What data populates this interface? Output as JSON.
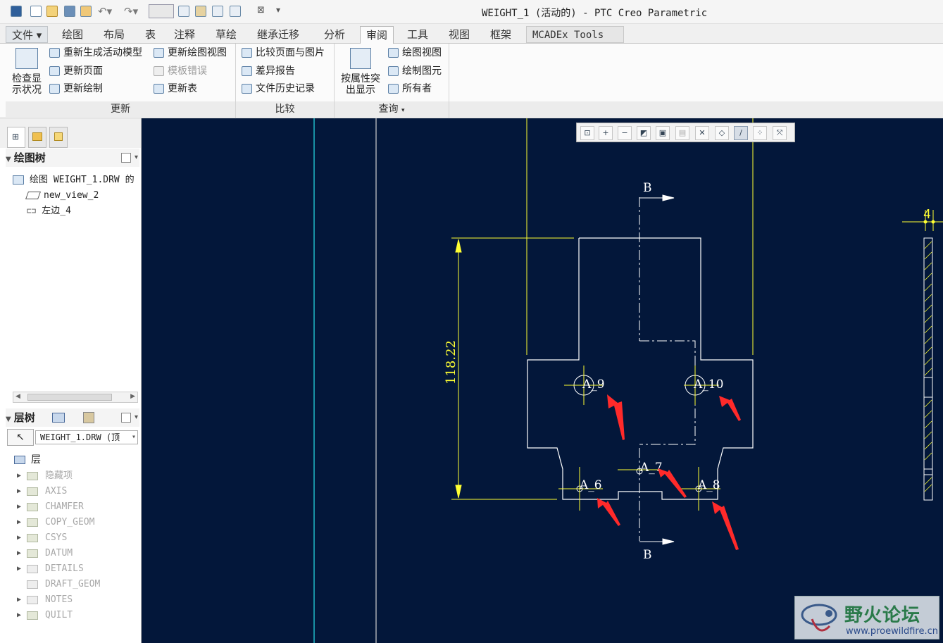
{
  "window": {
    "title": "WEIGHT_1 (活动的) - PTC Creo Parametric"
  },
  "tabs": [
    {
      "label": "文件"
    },
    {
      "label": "绘图"
    },
    {
      "label": "布局"
    },
    {
      "label": "表"
    },
    {
      "label": "注释"
    },
    {
      "label": "草绘"
    },
    {
      "label": "继承迁移"
    },
    {
      "label": "分析"
    },
    {
      "label": "审阅"
    },
    {
      "label": "工具"
    },
    {
      "label": "视图"
    },
    {
      "label": "框架"
    },
    {
      "label": "MCADEx Tools"
    }
  ],
  "ribbon": {
    "update": {
      "big_button": "检查显示状况",
      "big_button_line1": "检查显",
      "big_button_line2": "示状况",
      "items": [
        "重新生成活动模型",
        "更新页面",
        "更新绘制",
        "更新绘图视图",
        "模板错误",
        "更新表"
      ],
      "label": "更新"
    },
    "compare": {
      "items": [
        "比较页面与图片",
        "差异报告",
        "文件历史记录"
      ],
      "label": "比较"
    },
    "query": {
      "big_button_line1": "按属性突",
      "big_button_line2": "出显示",
      "items": [
        "绘图视图",
        "绘制图元",
        "所有者"
      ],
      "label": "查询"
    }
  },
  "drawing_tree": {
    "header": "绘图树",
    "items": [
      "绘图 WEIGHT_1.DRW 的",
      "new_view_2",
      "左边_4"
    ]
  },
  "layer_tree": {
    "header": "层树",
    "selector_value": "WEIGHT_1.DRW (顶",
    "root": "层",
    "layers": [
      "隐藏项",
      "AXIS",
      "CHAMFER",
      "COPY_GEOM",
      "CSYS",
      "DATUM",
      "DETAILS",
      "DRAFT_GEOM",
      "NOTES",
      "QUILT"
    ]
  },
  "drawing": {
    "dimension": "118.22",
    "section_label_top": "B",
    "section_label_bottom": "B",
    "side_view_label": "4",
    "annotations": [
      "A_9",
      "A_10",
      "A_6",
      "A_7",
      "A_8"
    ]
  },
  "watermark": {
    "title": "野火论坛",
    "url": "www.proewildfire.cn"
  },
  "colors": {
    "canvas_bg": "#03173a",
    "geometry": "#ffffff",
    "dimension": "#ffff33",
    "arrow_red": "#ff2a2a",
    "border_cyan": "#1fb8c8"
  }
}
